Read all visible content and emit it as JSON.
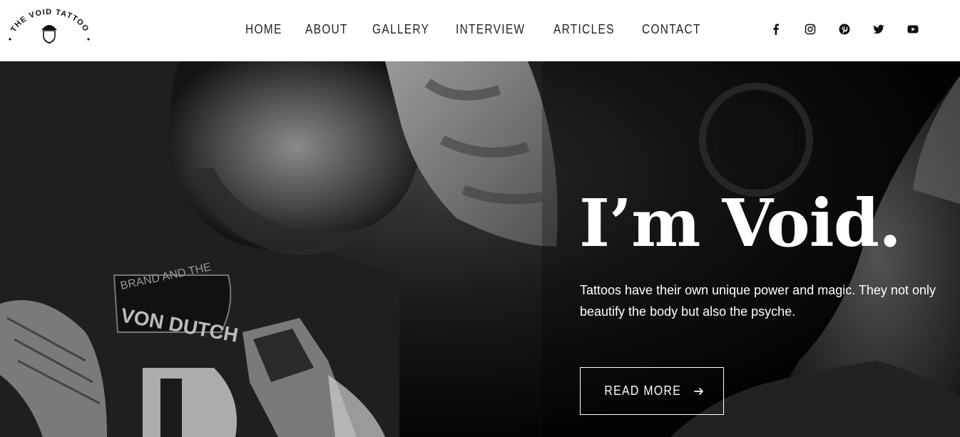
{
  "brand": {
    "logo_text": "THE VOID TATTOO"
  },
  "nav": {
    "items": [
      {
        "label": "HOME"
      },
      {
        "label": "ABOUT"
      },
      {
        "label": "GALLERY"
      },
      {
        "label": "INTERVIEW"
      },
      {
        "label": "ARTICLES"
      },
      {
        "label": "CONTACT"
      }
    ]
  },
  "social": [
    {
      "icon": "facebook-icon"
    },
    {
      "icon": "instagram-icon"
    },
    {
      "icon": "pinterest-icon"
    },
    {
      "icon": "twitter-icon"
    },
    {
      "icon": "youtube-icon"
    }
  ],
  "hero": {
    "title": "I’m Void.",
    "description": "Tattoos have their own unique power and magic. They not only beautify the body but also the psyche.",
    "button_label": "READ MORE",
    "shirt_text_1": "BRAND AND THE",
    "shirt_text_2": "VON DUTCH"
  },
  "colors": {
    "header_bg": "#ffffff",
    "nav_text": "#222222",
    "hero_bg": "#000000",
    "hero_text": "#ffffff"
  }
}
